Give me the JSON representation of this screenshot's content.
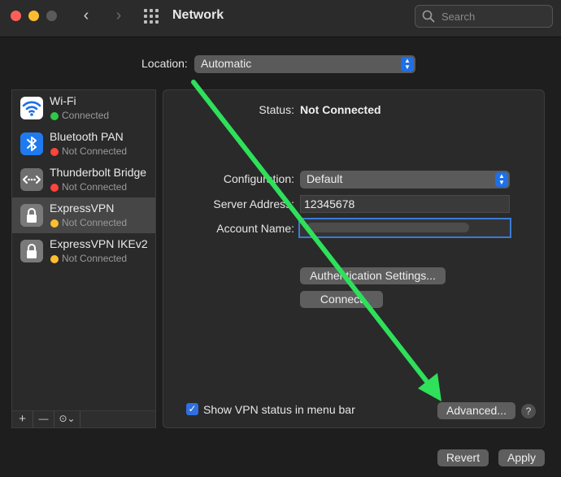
{
  "window": {
    "title": "Network"
  },
  "search": {
    "placeholder": "Search"
  },
  "location": {
    "label": "Location:",
    "value": "Automatic"
  },
  "services": [
    {
      "name": "Wi-Fi",
      "status": "Connected",
      "status_color": "#2ec946",
      "icon": "wifi-icon"
    },
    {
      "name": "Bluetooth PAN",
      "status": "Not Connected",
      "status_color": "#fe453b",
      "icon": "bluetooth-icon"
    },
    {
      "name": "Thunderbolt Bridge",
      "status": "Not Connected",
      "status_color": "#fe453b",
      "icon": "thunderbolt-bridge-icon"
    },
    {
      "name": "ExpressVPN",
      "status": "Not Connected",
      "status_color": "#fdbf2f",
      "icon": "lock-icon"
    },
    {
      "name": "ExpressVPN IKEv2",
      "status": "Not Connected",
      "status_color": "#fdbf2f",
      "icon": "lock-icon"
    }
  ],
  "sidebar_actions": {
    "add": "+",
    "remove": "—",
    "more": "⊙⌄"
  },
  "detail": {
    "status_label": "Status:",
    "status_value": "Not Connected",
    "configuration_label": "Configuration:",
    "configuration_value": "Default",
    "server_address_label": "Server Address:",
    "server_address_value": "12345678",
    "account_name_label": "Account Name:",
    "account_name_value": "",
    "auth_settings_button": "Authentication Settings...",
    "connect_button": "Connect",
    "show_vpn_status_label": "Show VPN status in menu bar",
    "advanced_button": "Advanced...",
    "help_button": "?"
  },
  "footer": {
    "revert": "Revert",
    "apply": "Apply"
  },
  "colors": {
    "accent": "#1f6fe6",
    "annotation_arrow": "#2ee05a"
  }
}
